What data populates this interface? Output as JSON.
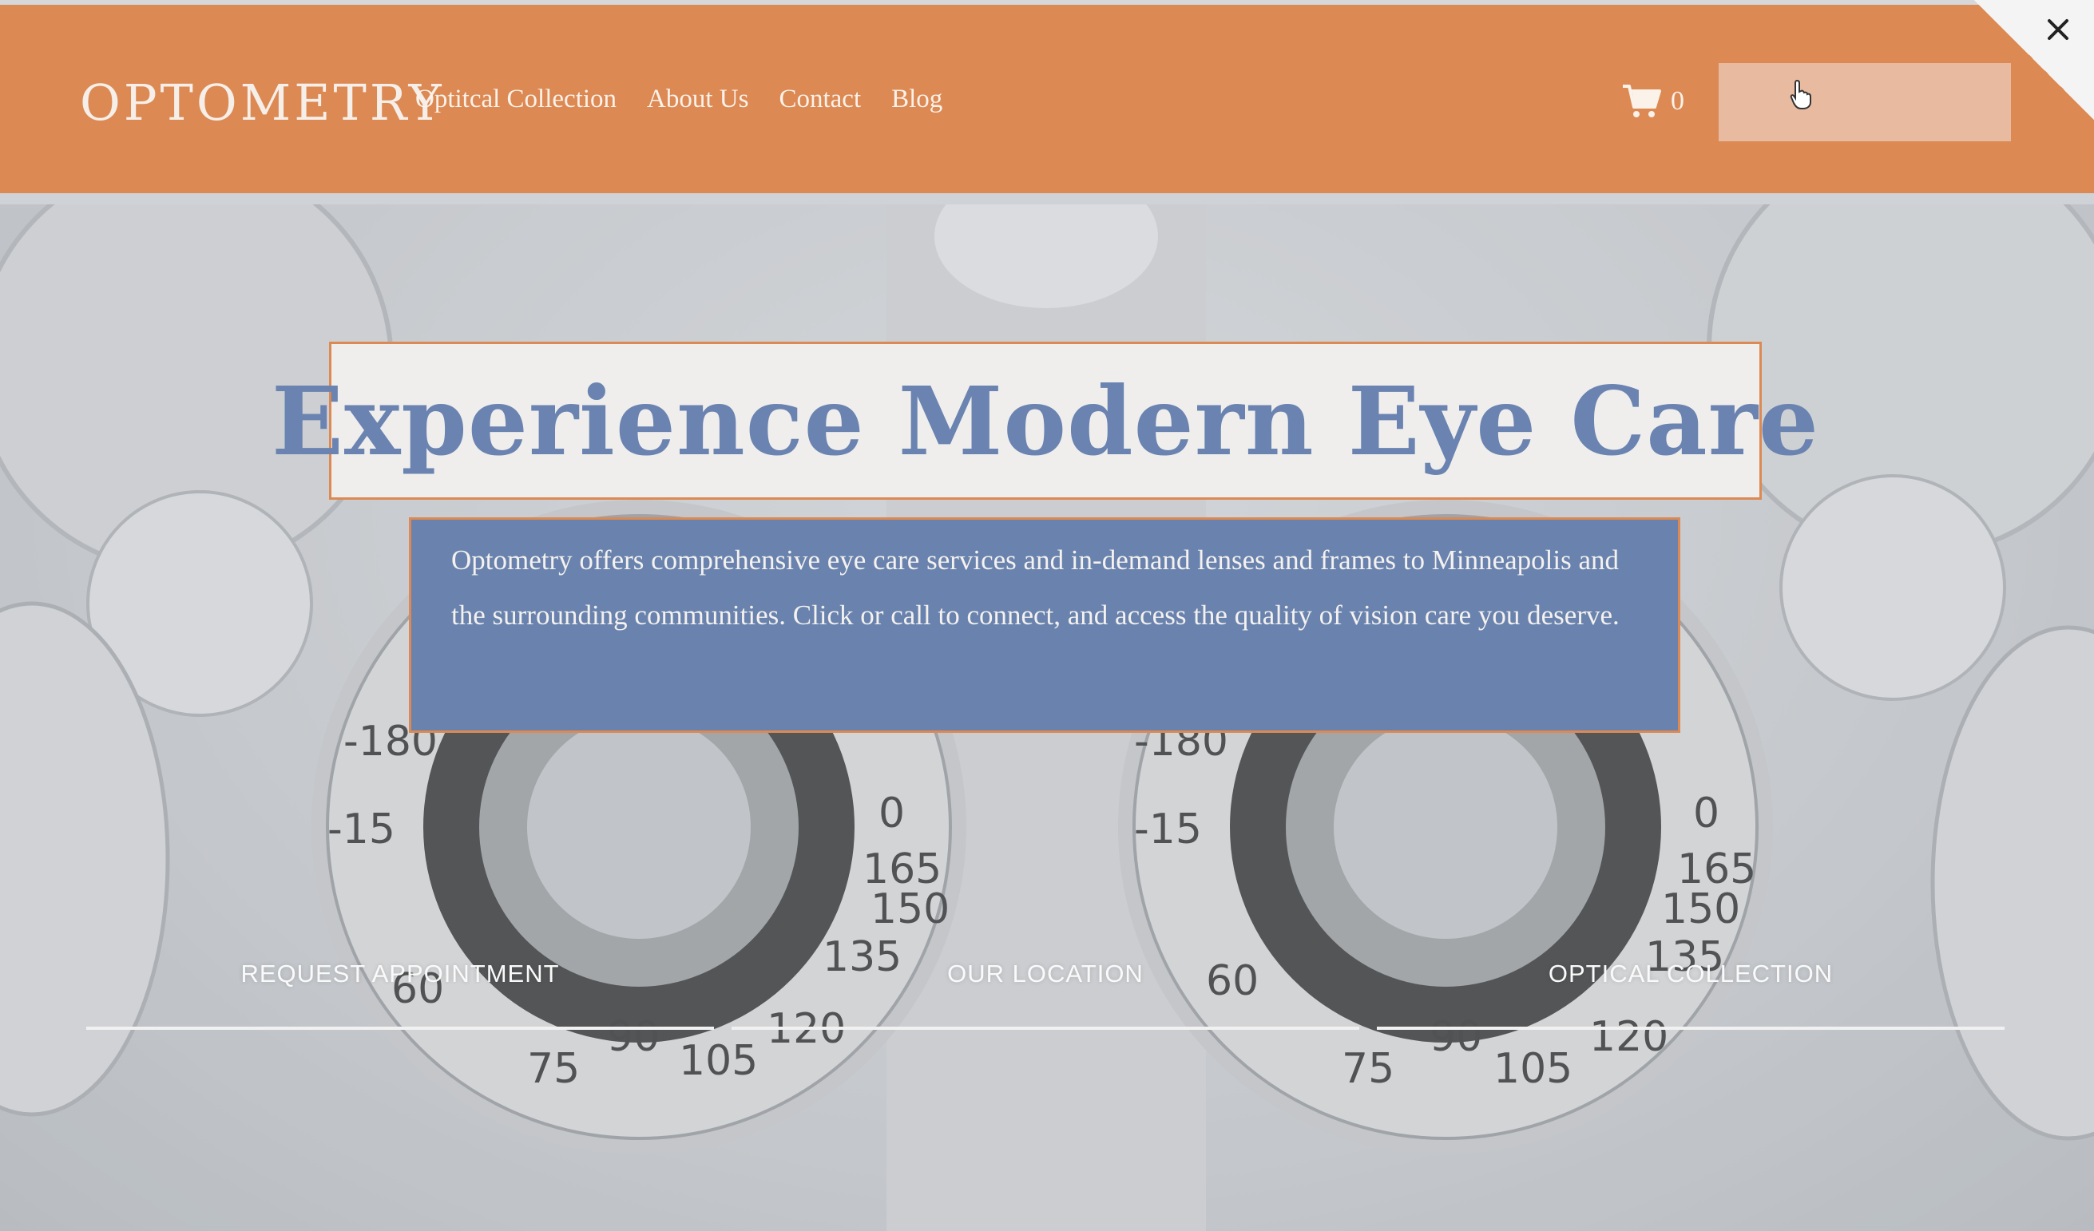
{
  "header": {
    "logo": "OPTOMETRY",
    "nav": [
      "Optitcal Collection",
      "About Us",
      "Contact",
      "Blog"
    ],
    "cart_count": "0",
    "colors": {
      "bar": "#dc8953",
      "button": "#e8bba1"
    }
  },
  "hero": {
    "headline": "Experience Modern Eye Care",
    "description": "Optometry offers comprehensive eye care services and in-demand lenses and frames to Minneapolis and the surrounding communities. Click or call to connect, and access the quality of vision care you deserve.",
    "links": [
      "REQUEST APPOINTMENT",
      "OUR LOCATION",
      "OPTICAL COLLECTION"
    ],
    "colors": {
      "headline": "#6a83b0",
      "description_bg": "#6983ae",
      "border": "#dc8953"
    }
  },
  "icons": [
    "cart-icon",
    "pointer-cursor-icon",
    "close-icon"
  ]
}
